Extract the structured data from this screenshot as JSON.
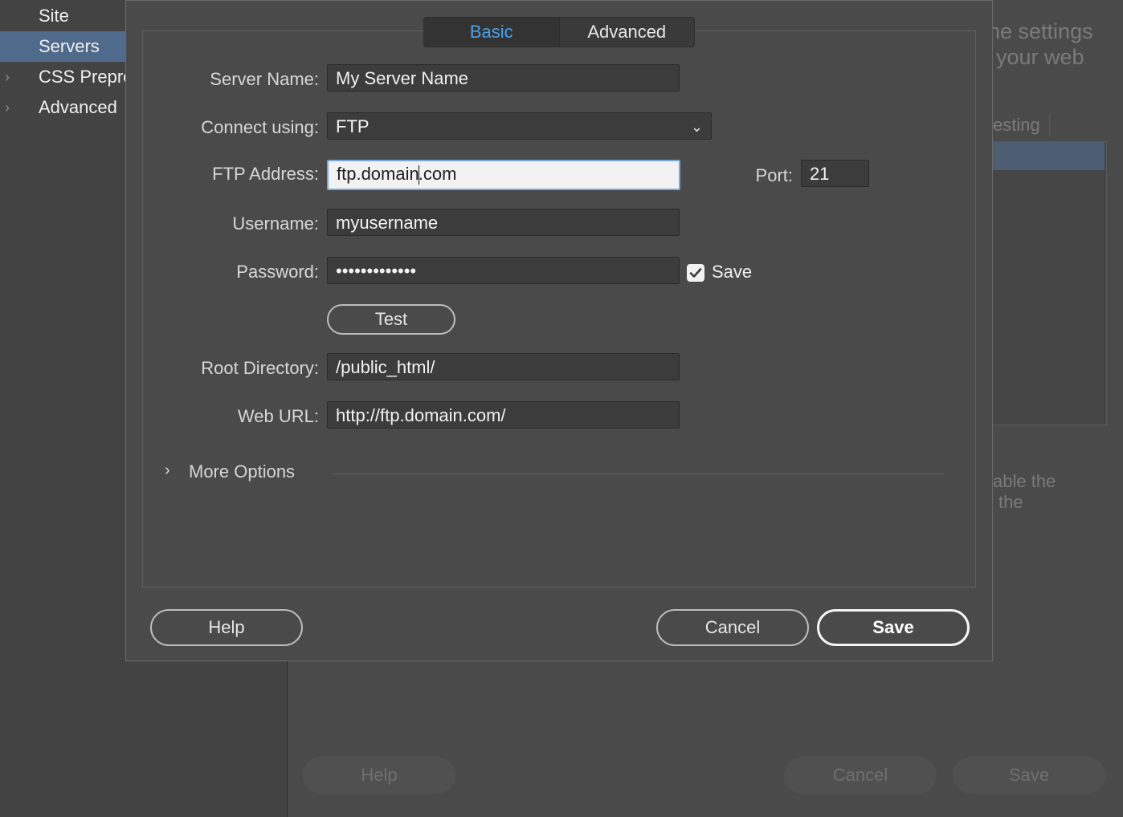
{
  "sidebar": {
    "items": [
      {
        "label": "Site",
        "active": false,
        "expandable": false
      },
      {
        "label": "Servers",
        "active": true,
        "expandable": false
      },
      {
        "label": "CSS Prepro",
        "active": false,
        "expandable": true
      },
      {
        "label": "Advanced",
        "active": false,
        "expandable": true
      }
    ]
  },
  "background": {
    "text_line1": "he settings",
    "text_line2": "your web",
    "tab_fragment": "esting",
    "text_line3": "able the",
    "text_line4": "the",
    "help_label": "Help",
    "cancel_label": "Cancel",
    "save_label": "Save"
  },
  "dialog": {
    "tabs": [
      {
        "label": "Basic",
        "selected": true
      },
      {
        "label": "Advanced",
        "selected": false
      }
    ],
    "server_name": {
      "label": "Server Name:",
      "value": "My Server Name"
    },
    "connect_using": {
      "label": "Connect using:",
      "value": "FTP"
    },
    "ftp_address": {
      "label": "FTP Address:",
      "value_before_caret": "ftp.domain",
      "value_after_caret": ".com"
    },
    "port": {
      "label": "Port:",
      "value": "21"
    },
    "username": {
      "label": "Username:",
      "value": "myusername"
    },
    "password": {
      "label": "Password:",
      "value": "•••••••••••••"
    },
    "save_password": {
      "label": "Save",
      "checked": true
    },
    "test_label": "Test",
    "root_directory": {
      "label": "Root Directory:",
      "value": "/public_html/"
    },
    "web_url": {
      "label": "Web URL:",
      "value": "http://ftp.domain.com/"
    },
    "more_options_label": "More Options",
    "help_label": "Help",
    "cancel_label": "Cancel",
    "save_label": "Save"
  },
  "colors": {
    "accent": "#4aa0ea",
    "sidebar_selected": "#4f6a8a"
  }
}
